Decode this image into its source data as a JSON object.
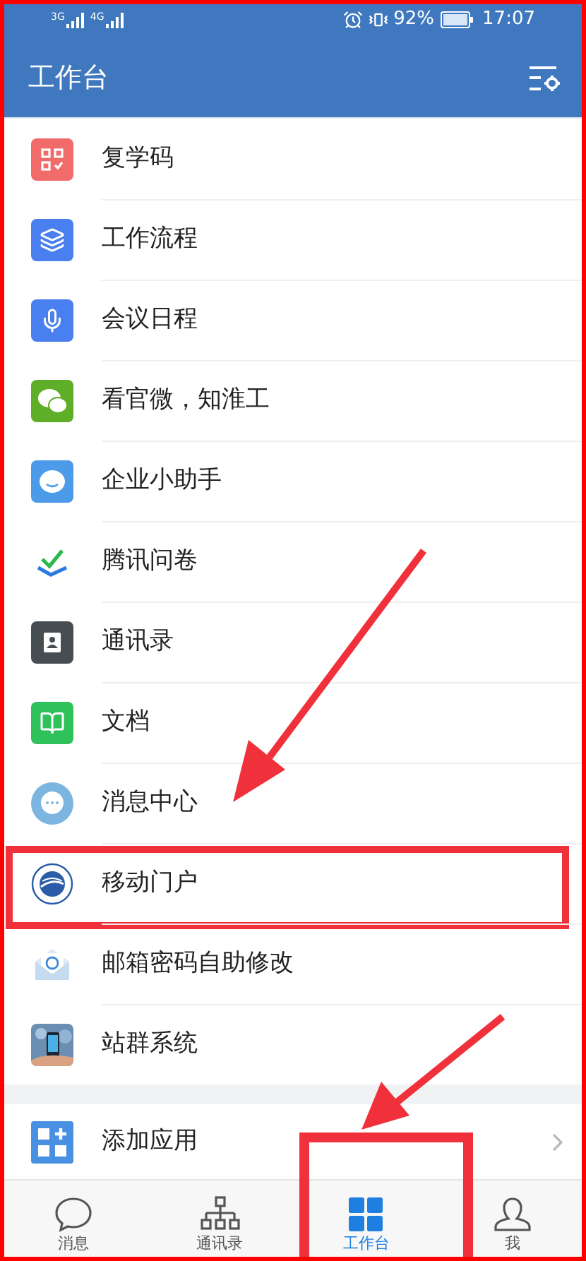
{
  "status_bar": {
    "networks": [
      "3G",
      "4G"
    ],
    "battery_percent": "92%",
    "time": "17:07"
  },
  "header": {
    "title": "工作台"
  },
  "apps": [
    {
      "label": "复学码",
      "kind": "qrcode",
      "highlighted": false
    },
    {
      "label": "工作流程",
      "kind": "layers",
      "highlighted": false
    },
    {
      "label": "会议日程",
      "kind": "mic",
      "highlighted": false
    },
    {
      "label": "看官微，知淮工",
      "kind": "wechat",
      "highlighted": false
    },
    {
      "label": "企业小助手",
      "kind": "smile",
      "highlighted": false
    },
    {
      "label": "腾讯问卷",
      "kind": "check",
      "highlighted": false
    },
    {
      "label": "通讯录",
      "kind": "contacts",
      "highlighted": false
    },
    {
      "label": "文档",
      "kind": "book",
      "highlighted": false
    },
    {
      "label": "消息中心",
      "kind": "chat",
      "highlighted": false
    },
    {
      "label": "移动门户",
      "kind": "emblem",
      "highlighted": true
    },
    {
      "label": "邮箱密码自助修改",
      "kind": "mail",
      "highlighted": false
    },
    {
      "label": "站群系统",
      "highlighted": false
    }
  ],
  "add_app": {
    "label": "添加应用"
  },
  "tabs": [
    {
      "label": "消息",
      "kind": "bubble",
      "selected": false,
      "highlighted": false
    },
    {
      "label": "通讯录",
      "kind": "org",
      "selected": false,
      "highlighted": false
    },
    {
      "label": "工作台",
      "kind": "grid",
      "selected": true,
      "highlighted": true
    },
    {
      "label": "我",
      "kind": "person",
      "selected": false,
      "highlighted": false
    }
  ]
}
